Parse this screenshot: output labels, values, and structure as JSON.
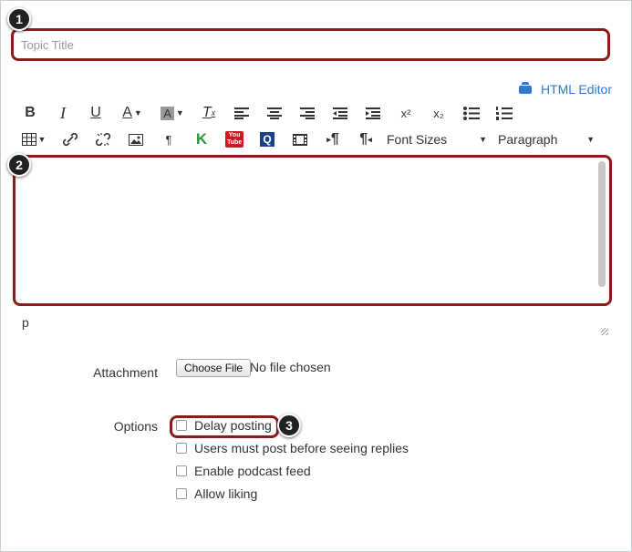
{
  "title_input": {
    "placeholder": "Topic Title"
  },
  "markers": {
    "one": "1",
    "two": "2",
    "three": "3"
  },
  "html_editor": {
    "label": "HTML Editor"
  },
  "toolbar": {
    "bold": "B",
    "italic": "I",
    "underline": "U",
    "text_color": "A",
    "bg_color": "A",
    "clear": "T",
    "superscript": "x²",
    "subscript": "x₂",
    "paragraph_mark": "¶",
    "kaltura": "K",
    "youtube": "You Tube",
    "quizlet": "Q",
    "ltr": "¶",
    "rtl": "¶",
    "font_sizes": "Font Sizes",
    "block_format": "Paragraph"
  },
  "editor": {
    "path": "p"
  },
  "attachment": {
    "label": "Attachment",
    "button": "Choose File",
    "status": "No file chosen"
  },
  "options": {
    "label": "Options",
    "items": [
      {
        "label": "Delay posting"
      },
      {
        "label": "Users must post before seeing replies"
      },
      {
        "label": "Enable podcast feed"
      },
      {
        "label": "Allow liking"
      }
    ]
  },
  "colors": {
    "highlight": "#8b1c1c",
    "link": "#2d7bd0"
  }
}
